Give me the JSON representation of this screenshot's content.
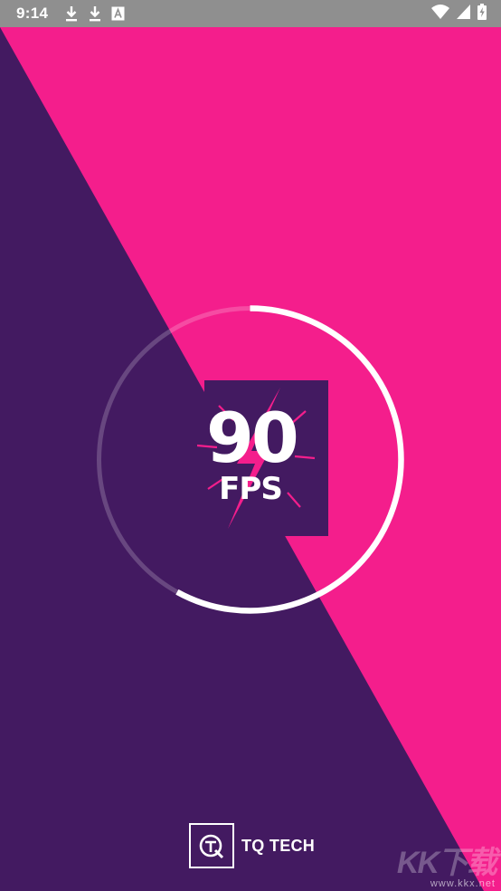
{
  "status_bar": {
    "time": "9:14",
    "left_icons": [
      "download-icon",
      "download-icon",
      "text-a-icon"
    ],
    "right_icons": [
      "wifi-icon",
      "signal-icon",
      "battery-icon"
    ]
  },
  "splash": {
    "logo_number": "90",
    "logo_unit": "FPS",
    "loading_progress": 0.58
  },
  "brand": {
    "name": "TQ TECH",
    "emblem_icon": "tq-logo-icon"
  },
  "watermark": {
    "logo": "KK下载",
    "url": "www.kkx.net"
  },
  "colors": {
    "pink": "#f41e8c",
    "purple": "#431a61",
    "status_bar": "#8f8f8f",
    "white": "#ffffff"
  }
}
